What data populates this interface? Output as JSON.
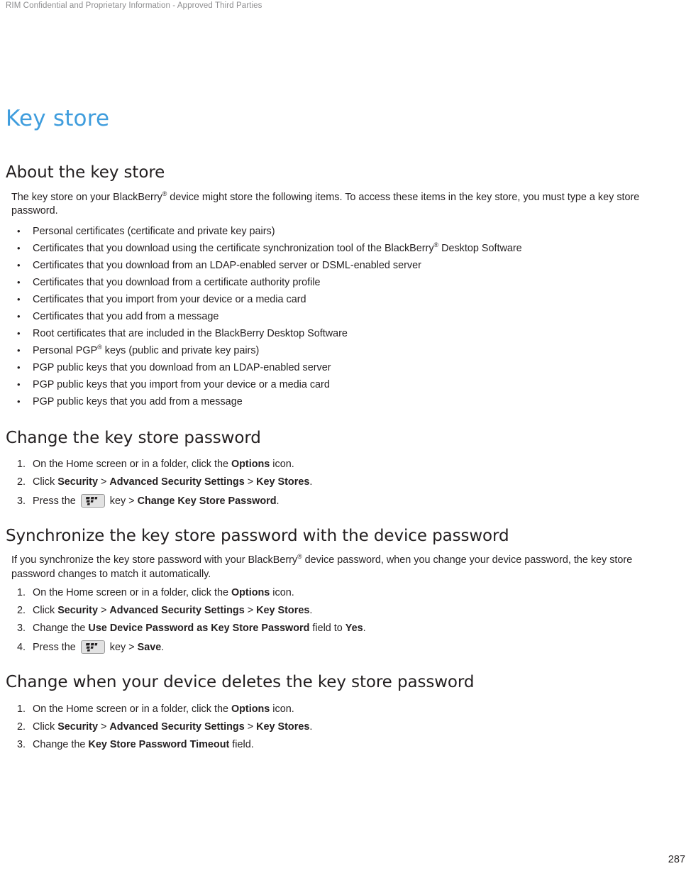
{
  "header": {
    "running_header": "RIM Confidential and Proprietary Information - Approved Third Parties"
  },
  "doc": {
    "title": "Key store",
    "title_color": "#3f9ddd",
    "page_number": "287"
  },
  "sections": [
    {
      "heading": "About the key store",
      "paragraph_before": "The key store on your BlackBerry® device might store the following items. To access these items in the key store, you must type a key store password.",
      "bullets": [
        "Personal certificates (certificate and private key pairs)",
        "Certificates that you download using the certificate synchronization tool of the BlackBerry® Desktop Software",
        "Certificates that you download from an LDAP-enabled server or DSML-enabled server",
        "Certificates that you download from a certificate authority profile",
        "Certificates that you import from your device or a media card",
        "Certificates that you add from a message",
        "Root certificates that are included in the BlackBerry Desktop Software",
        "Personal PGP® keys (public and private key pairs)",
        "PGP public keys that you download from an LDAP-enabled server",
        "PGP public keys that you import from your device or a media card",
        "PGP public keys that you add from a message"
      ]
    },
    {
      "heading": "Change the key store password",
      "steps": [
        {
          "parts": [
            {
              "t": "On the Home screen or in a folder, click the ",
              "b": false
            },
            {
              "t": "Options",
              "b": true
            },
            {
              "t": " icon.",
              "b": false
            }
          ]
        },
        {
          "parts": [
            {
              "t": "Click ",
              "b": false
            },
            {
              "t": "Security",
              "b": true
            },
            {
              "t": " > ",
              "b": false
            },
            {
              "t": "Advanced Security Settings",
              "b": true
            },
            {
              "t": " > ",
              "b": false
            },
            {
              "t": "Key Stores",
              "b": true
            },
            {
              "t": ".",
              "b": false
            }
          ]
        },
        {
          "has_key_icon": true,
          "parts": [
            {
              "t": "Press the ",
              "b": false
            },
            {
              "icon": "blackberry-menu-key"
            },
            {
              "t": " key > ",
              "b": false
            },
            {
              "t": "Change Key Store Password",
              "b": true
            },
            {
              "t": ".",
              "b": false
            }
          ]
        }
      ]
    },
    {
      "heading": "Synchronize the key store password with the device password",
      "paragraph_before": "If you synchronize the key store password with your BlackBerry® device password, when you change your device password, the key store password changes to match it automatically.",
      "steps": [
        {
          "parts": [
            {
              "t": "On the Home screen or in a folder, click the ",
              "b": false
            },
            {
              "t": "Options",
              "b": true
            },
            {
              "t": " icon.",
              "b": false
            }
          ]
        },
        {
          "parts": [
            {
              "t": "Click ",
              "b": false
            },
            {
              "t": "Security",
              "b": true
            },
            {
              "t": " > ",
              "b": false
            },
            {
              "t": "Advanced Security Settings",
              "b": true
            },
            {
              "t": " > ",
              "b": false
            },
            {
              "t": "Key Stores",
              "b": true
            },
            {
              "t": ".",
              "b": false
            }
          ]
        },
        {
          "parts": [
            {
              "t": "Change the ",
              "b": false
            },
            {
              "t": "Use Device Password as Key Store Password",
              "b": true
            },
            {
              "t": " field to ",
              "b": false
            },
            {
              "t": "Yes",
              "b": true
            },
            {
              "t": ".",
              "b": false
            }
          ]
        },
        {
          "has_key_icon": true,
          "parts": [
            {
              "t": "Press the ",
              "b": false
            },
            {
              "icon": "blackberry-menu-key"
            },
            {
              "t": " key > ",
              "b": false
            },
            {
              "t": "Save",
              "b": true
            },
            {
              "t": ".",
              "b": false
            }
          ]
        }
      ]
    },
    {
      "heading": "Change when your device deletes the key store password",
      "steps": [
        {
          "parts": [
            {
              "t": "On the Home screen or in a folder, click the ",
              "b": false
            },
            {
              "t": "Options",
              "b": true
            },
            {
              "t": " icon.",
              "b": false
            }
          ]
        },
        {
          "parts": [
            {
              "t": "Click ",
              "b": false
            },
            {
              "t": "Security",
              "b": true
            },
            {
              "t": " > ",
              "b": false
            },
            {
              "t": "Advanced Security Settings",
              "b": true
            },
            {
              "t": " > ",
              "b": false
            },
            {
              "t": "Key Stores",
              "b": true
            },
            {
              "t": ".",
              "b": false
            }
          ]
        },
        {
          "parts": [
            {
              "t": "Change the ",
              "b": false
            },
            {
              "t": "Key Store Password Timeout",
              "b": true
            },
            {
              "t": " field.",
              "b": false
            }
          ]
        }
      ]
    }
  ]
}
